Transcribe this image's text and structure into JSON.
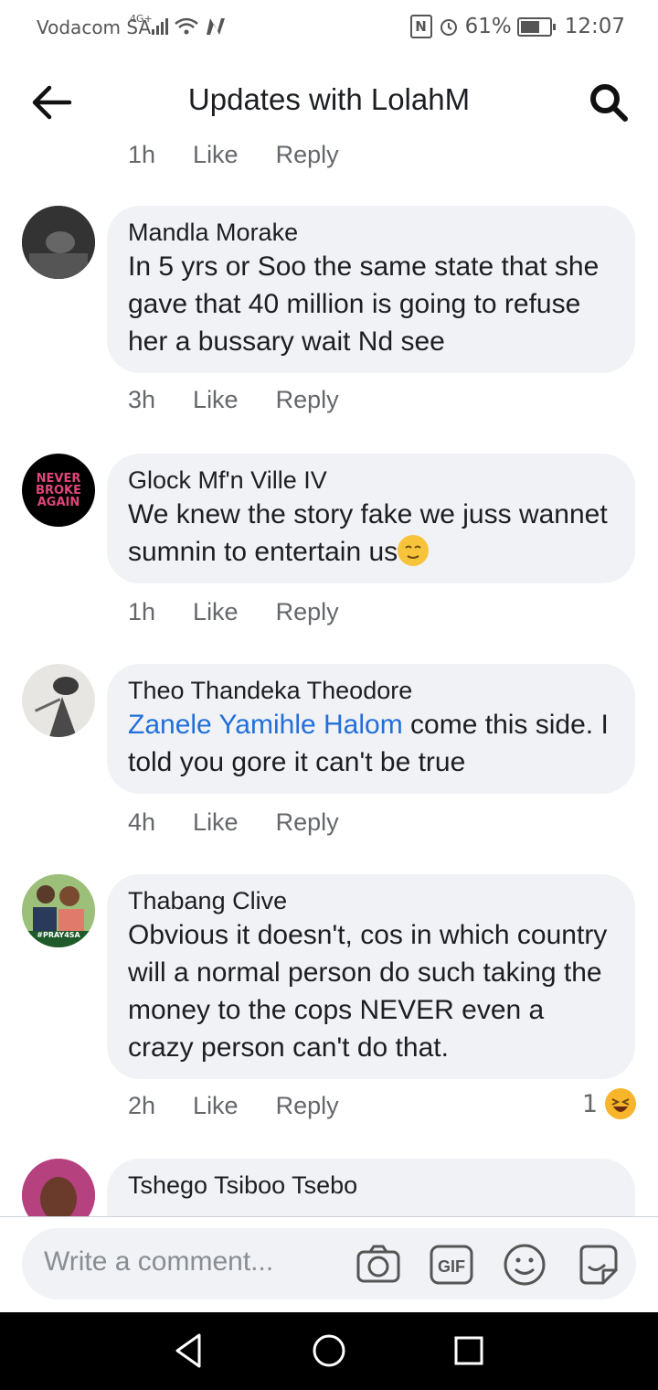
{
  "status_bar": {
    "carrier": "Vodacom SA",
    "network": "4G+",
    "battery": "61%",
    "time": "12:07"
  },
  "header": {
    "title": "Updates with LolahM"
  },
  "partial_top": {
    "time": "1h",
    "like": "Like",
    "reply": "Reply"
  },
  "comments": [
    {
      "name": "Mandla Morake",
      "text": "In 5 yrs or Soo the same state that she gave that  40 million    is going to refuse her a bussary   wait Nd see",
      "time": "3h",
      "like": "Like",
      "reply": "Reply"
    },
    {
      "name": "Glock Mf'n Ville IV",
      "text": "We knew the story fake we juss wannet sumnin to entertain us",
      "avatar_text": "NEVER BROKE AGAIN",
      "time": "1h",
      "like": "Like",
      "reply": "Reply"
    },
    {
      "name": "Theo Thandeka Theodore",
      "tag": "Zanele Yamihle Halom",
      "text": " come this side. I told you gore it can't be true",
      "time": "4h",
      "like": "Like",
      "reply": "Reply"
    },
    {
      "name": "Thabang Clive",
      "text": "Obvious it doesn't, cos in which country will a normal person do such taking the money to the cops NEVER even a crazy person can't do that.",
      "avatar_text": "#PRAY4SA",
      "time": "2h",
      "like": "Like",
      "reply": "Reply",
      "reaction_count": "1"
    },
    {
      "name": "Tshego Tsiboo Tsebo"
    }
  ],
  "composer": {
    "placeholder": "Write a comment..."
  },
  "colors": {
    "bubble": "#f0f2f5",
    "link": "#216fdb",
    "meta": "#65676b",
    "emoji": "#f7c33b"
  }
}
